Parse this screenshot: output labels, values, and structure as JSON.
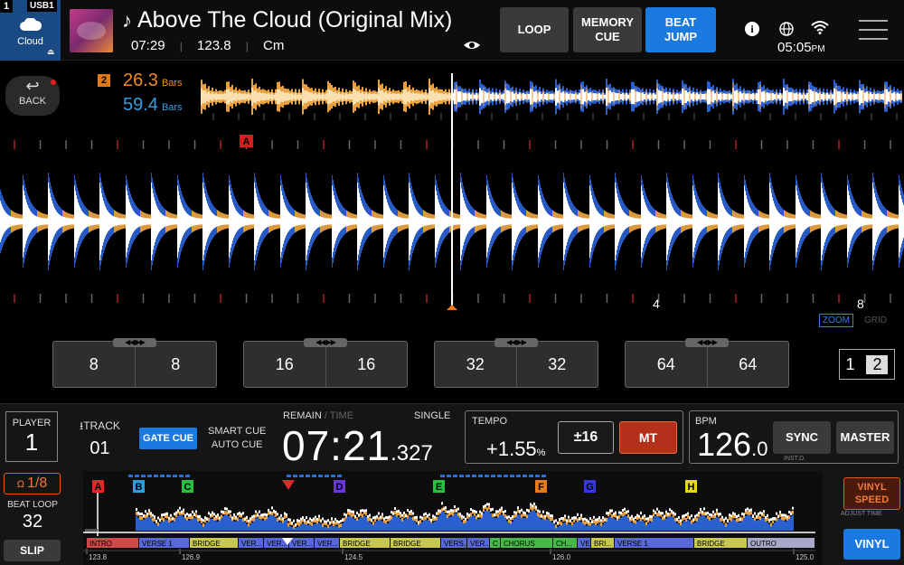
{
  "header": {
    "deck_number": "1",
    "source_tag": "USB1",
    "source_label": "Cloud",
    "track_title": "Above The Cloud (Original Mix)",
    "track_length": "07:29",
    "track_bpm": "123.8",
    "track_key": "Cm",
    "loop_label": "LOOP",
    "memory_cue_label": "MEMORY\nCUE",
    "beat_jump_label": "BEAT\nJUMP",
    "clock_time": "05:05",
    "clock_ampm": "PM"
  },
  "waveform": {
    "back_label": "BACK",
    "loop_slot": "2",
    "bars_orange_value": "26.3",
    "bars_blue_value": "59.4",
    "bars_unit": "Bars",
    "hot_cue_marker": "A",
    "beat_label_4": "4",
    "beat_label_8": "8",
    "zoom_label": "ZOOM",
    "grid_label": "GRID"
  },
  "beat_jump_pads": [
    {
      "left": "8",
      "right": "8"
    },
    {
      "left": "16",
      "right": "16"
    },
    {
      "left": "32",
      "right": "32"
    },
    {
      "left": "64",
      "right": "64"
    }
  ],
  "pad_page": {
    "page1": "1",
    "page2": "2"
  },
  "status": {
    "player_label": "PLAYER",
    "player_value": "1",
    "track_label": "TRACK",
    "track_value": "01",
    "gate_cue_label": "GATE CUE",
    "smart_cue_label": "SMART CUE",
    "auto_cue_label": "AUTO CUE",
    "remain_label": "REMAIN",
    "time_label": "TIME",
    "single_label": "SINGLE",
    "time_main": "07:21",
    "time_ms": ".327",
    "tempo_label": "TEMPO",
    "tempo_value": "+1.55",
    "tempo_unit": "%",
    "tempo_range": "±16",
    "mt_label": "MT",
    "bpm_label": "BPM",
    "bpm_value": "126",
    "bpm_decimal": ".0",
    "sync_label": "SYNC",
    "inst_label": "INST.D.",
    "master_label": "MASTER",
    "beat_loop_value": "1/8",
    "beat_loop_label": "BEAT LOOP",
    "beat_loop_count": "32",
    "slip_label": "SLIP",
    "vinyl_speed_label": "VINYL\nSPEED",
    "adjust_time_label": "ADJUST TIME",
    "vinyl_label": "VINYL"
  },
  "overview": {
    "hot_cues": [
      {
        "label": "A",
        "color": "#e02828"
      },
      {
        "label": "B",
        "color": "#28a0e0"
      },
      {
        "label": "C",
        "color": "#28c040"
      },
      {
        "label": "D",
        "color": "#6a38d8"
      },
      {
        "label": "E",
        "color": "#28c040"
      },
      {
        "label": "F",
        "color": "#e87a1a"
      },
      {
        "label": "G",
        "color": "#3838d8"
      },
      {
        "label": "H",
        "color": "#e8d81a"
      }
    ],
    "phrases": [
      "INTRO",
      "VERSE 1",
      "BRIDGE",
      "VER...",
      "VER...",
      "VER...",
      "VER...",
      "BRIDGE",
      "BRIDGE",
      "VERS...",
      "VER...",
      "C",
      "CHORUS",
      "CH...",
      "VE",
      "BRI...",
      "VERSE 1",
      "BRIDGE",
      "OUTRO"
    ],
    "bpm_markers": [
      "123.8",
      "126.9",
      "124.5",
      "126.0",
      "125.0"
    ]
  }
}
